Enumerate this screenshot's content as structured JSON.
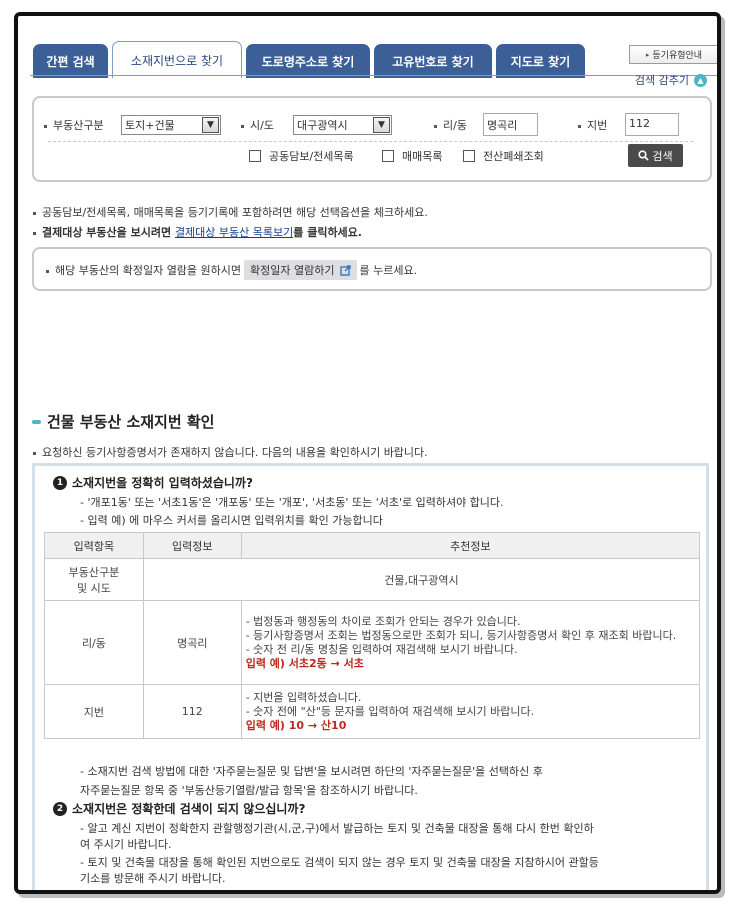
{
  "tabs": [
    {
      "label": "간편 검색"
    },
    {
      "label": "소재지번으로 찾기"
    },
    {
      "label": "도로명주소로 찾기"
    },
    {
      "label": "고유번호로 찾기"
    },
    {
      "label": "지도로 찾기"
    }
  ],
  "reg_guide_label": "등기유형안내",
  "hide_search_label": "검색 감추기",
  "search": {
    "property_type_label": "부동산구분",
    "property_type_value": "토지+건물",
    "sido_label": "시/도",
    "sido_value": "대구광역시",
    "ridong_label": "리/동",
    "ridong_value": "명곡리",
    "jibun_label": "지번",
    "jibun_value": "112",
    "checkboxes": [
      {
        "label": "공동담보/전세목록"
      },
      {
        "label": "매매목록"
      },
      {
        "label": "전산폐쇄조회"
      }
    ],
    "search_button": "검색"
  },
  "notes": {
    "line1": "공동담보/전세목록, 매매목록을 등기기록에 포함하려면 해당 선택옵션을 체크하세요.",
    "line2_pre": "결제대상 부동산을 보시려면 ",
    "line2_link": "결제대상 부동산 목록보기",
    "line2_post": "를 클릭하세요.",
    "confirm_pre": "해당 부동산의 확정일자 열람을 원하시면",
    "confirm_button": "확정일자 열람하기",
    "confirm_post": "를 누르세요."
  },
  "result": {
    "section_title": "건물 부동산 소재지번 확인",
    "intro": "요청하신 등기사항증명서가 존재하지 않습니다. 다음의 내용을 확인하시기 바랍니다.",
    "q1_num": "1",
    "q1_title": "소재지번을 정확히 입력하셨습니까?",
    "q1_line1": "- '개포1동' 또는 '서초1동'은 '개포동' 또는 '개포', '서초동' 또는 '서초'로 입력하셔야 합니다.",
    "q1_line2": "- 입력 예) 에 마우스 커서를 올리시면 입력위치를 확인 가능합니다",
    "table": {
      "headers": [
        "입력항목",
        "입력정보",
        "추천정보"
      ],
      "row1": {
        "item_line1": "부동산구분",
        "item_line2": "및 시도",
        "rec": "건물,대구광역시"
      },
      "row2": {
        "item": "리/동",
        "info": "명곡리",
        "rec1": "- 법정동과 행정동의 차이로 조회가 안되는 경우가 있습니다.",
        "rec2": "- 등기사항증명서 조회는 법정동으로만 조회가 되니, 등기사항증명서 확인 후 재조회 바랍니다.",
        "rec3": "- 숫자 전 리/동 명칭을 입력하여 재검색해 보시기 바랍니다.",
        "example": "입력 예) 서초2동 → 서초"
      },
      "row3": {
        "item": "지번",
        "info": "112",
        "rec1": "- 지번을 입력하셨습니다.",
        "rec2": "- 숫자 전에 \"산\"등 문자를 입력하여 재검색해 보시기 바랍니다.",
        "example": "입력 예) 10 → 산10"
      }
    },
    "faq_line1": "- 소재지번 검색 방법에 대한 '자주묻는질문 및 답변'을 보시려면 하단의 '자주묻는질문'을 선택하신 후",
    "faq_line2": "자주묻는질문 항목 중 '부동산등기열람/발급 항목'을 참조하시기 바랍니다.",
    "q2_num": "2",
    "q2_title": "소재지번은 정확한데 검색이 되지 않으십니까?",
    "q2_line1": "- 알고 계신 지번이 정확한지 관할행정기관(시,군,구)에서 발급하는 토지 및 건축물 대장을 통해 다시 한번 확인하",
    "q2_line2": "여 주시기 바랍니다.",
    "q2_line3": "- 토지 및 건축물 대장을 통해 확인된 지번으로도 검색이 되지 않는 경우 토지 및 건축물 대장을 지참하시어 관할등",
    "q2_line4": "기소를 방문해 주시기 바랍니다."
  }
}
